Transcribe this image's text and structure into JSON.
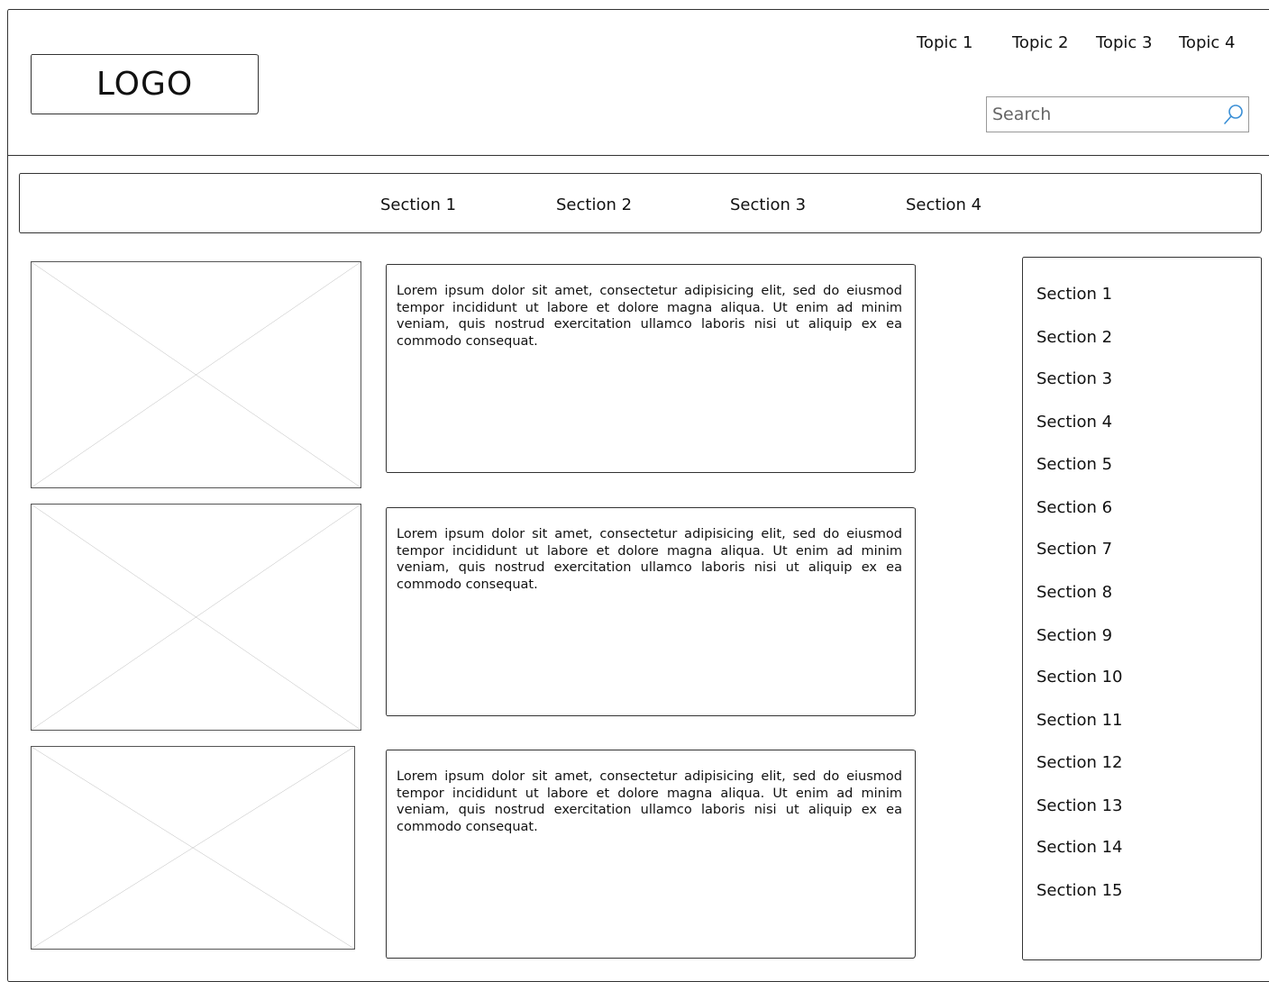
{
  "header": {
    "logo_text": "LOGO",
    "topics": [
      "Topic 1",
      "Topic 2",
      "Topic 3",
      "Topic 4"
    ],
    "search": {
      "placeholder": "Search",
      "value": ""
    }
  },
  "section_nav": {
    "items": [
      "Section 1",
      "Section 2",
      "Section 3",
      "Section 4"
    ]
  },
  "articles": [
    {
      "text": "Lorem ipsum dolor sit amet, consectetur adipisicing elit, sed do eiusmod tempor incididunt ut labore et dolore magna aliqua. Ut enim ad minim veniam, quis nostrud exercitation ullamco laboris nisi ut aliquip ex ea commodo consequat."
    },
    {
      "text": "Lorem ipsum dolor sit amet, consectetur adipisicing elit, sed do eiusmod tempor incididunt ut labore et dolore magna aliqua. Ut enim ad minim veniam, quis nostrud exercitation ullamco laboris nisi ut aliquip ex ea commodo consequat."
    },
    {
      "text": "Lorem ipsum dolor sit amet, consectetur adipisicing elit, sed do eiusmod tempor incididunt ut labore et dolore magna aliqua. Ut enim ad minim veniam, quis nostrud exercitation ullamco laboris nisi ut aliquip ex ea commodo consequat."
    }
  ],
  "sidebar": {
    "items": [
      "Section 1",
      "Section 2",
      "Section 3",
      "Section 4",
      "Section 5",
      "Section 6",
      "Section 7",
      "Section 8",
      "Section 9",
      "Section 10",
      "Section 11",
      "Section 12",
      "Section 13",
      "Section 14",
      "Section 15"
    ]
  },
  "icons": {
    "search": "search-icon",
    "image_placeholder": "image-placeholder-icon"
  },
  "colors": {
    "line": "#333333",
    "placeholder_line": "#aaaaaa",
    "search_icon": "#3a8fd6"
  }
}
